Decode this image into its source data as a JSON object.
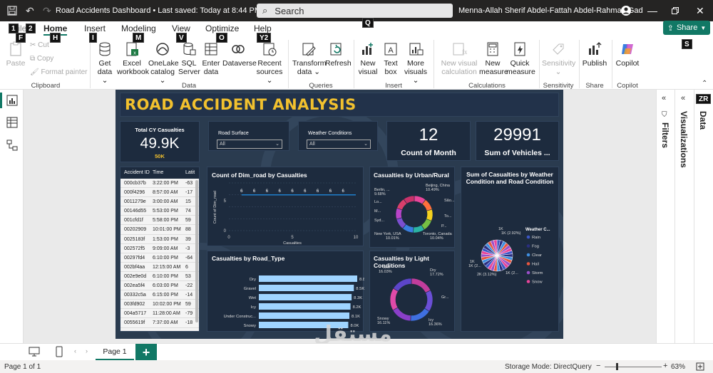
{
  "window": {
    "title": "Road Accidents Dashboard",
    "saved": "Last saved: Today at 8:44 PM",
    "search_placeholder": "Search",
    "user": "Menna-Allah Sherif Abdel-Fattah Abdel-Rahman Gad"
  },
  "keytips": [
    "1",
    "2",
    "F",
    "H",
    "I",
    "M",
    "V",
    "O",
    "Y2",
    "Q",
    "S",
    "ZR"
  ],
  "tabs": [
    "File",
    "Home",
    "Insert",
    "Modeling",
    "View",
    "Optimize",
    "Help"
  ],
  "share_label": "Share",
  "ribbon": {
    "clipboard": {
      "paste": "Paste",
      "cut": "Cut",
      "copy": "Copy",
      "format_painter": "Format painter",
      "label": "Clipboard"
    },
    "data": {
      "get_data": [
        "Get",
        "data"
      ],
      "excel": [
        "Excel",
        "workbook"
      ],
      "onelake": [
        "OneLake",
        "catalog"
      ],
      "sql": [
        "SQL",
        "Server"
      ],
      "enter": [
        "Enter",
        "data"
      ],
      "dataverse": "Dataverse",
      "recent": [
        "Recent",
        "sources"
      ],
      "label": "Data"
    },
    "queries": {
      "transform": [
        "Transform",
        "data"
      ],
      "refresh": "Refresh",
      "label": "Queries"
    },
    "insert": {
      "new_visual": [
        "New",
        "visual"
      ],
      "text_box": [
        "Text",
        "box"
      ],
      "more_visuals": [
        "More",
        "visuals"
      ],
      "label": "Insert"
    },
    "calculations": {
      "new_visual_calc": [
        "New visual",
        "calculation"
      ],
      "new_measure": [
        "New",
        "measure"
      ],
      "quick_measure": [
        "Quick",
        "measure"
      ],
      "label": "Calculations"
    },
    "sensitivity": {
      "btn": "Sensitivity",
      "label": "Sensitivity"
    },
    "share": {
      "publish": "Publish",
      "label": "Share"
    },
    "copilot": {
      "btn": "Copilot",
      "label": "Copilot"
    }
  },
  "panes": {
    "filters": "Filters",
    "visualizations": "Visualizations",
    "data": "Data"
  },
  "report": {
    "title": "ROAD ACCIDENT ANALYSIS",
    "kpi_total": {
      "label": "Total CY Casualties",
      "value": "49.9K",
      "sub": "50K"
    },
    "slicer_road": {
      "label": "Road Surface",
      "value": "All"
    },
    "slicer_weather": {
      "label": "Weather Conditions",
      "value": "All"
    },
    "kpi_month": {
      "value": "12",
      "label": "Count of Month"
    },
    "kpi_vehicles": {
      "value": "29991",
      "label": "Sum of Vehicles ..."
    },
    "table": {
      "headers": [
        "Accident ID",
        "Time",
        "Latit"
      ],
      "rows": [
        [
          "000cb37b",
          "3:22:00 PM",
          "-63"
        ],
        [
          "000f4296",
          "8:57:00 AM",
          "-17"
        ],
        [
          "0011279e",
          "3:00:00 AM",
          "15"
        ],
        [
          "00146d55",
          "5:53:00 PM",
          "74"
        ],
        [
          "001cfd1f",
          "5:58:00 PM",
          "59"
        ],
        [
          "00202909",
          "10:01:00 PM",
          "88"
        ],
        [
          "0025183f",
          "1:53:00 PM",
          "39"
        ],
        [
          "002572f5",
          "9:09:00 AM",
          "-3"
        ],
        [
          "00297fd4",
          "6:10:00 PM",
          "-64"
        ],
        [
          "002bf4aa",
          "12:15:00 AM",
          "6"
        ],
        [
          "002e9e0d",
          "6:10:00 PM",
          "53"
        ],
        [
          "002ea5f4",
          "6:03:00 PM",
          "-22"
        ],
        [
          "00332c5a",
          "6:15:00 PM",
          "-14"
        ],
        [
          "003fd902",
          "10:02:00 PM",
          "59"
        ],
        [
          "004a5717",
          "11:28:00 AM",
          "-79"
        ],
        [
          "0055619f",
          "7:37:00 AM",
          "-18"
        ]
      ]
    },
    "line_title": "Count of Dim_road by Casualties",
    "bar_title": "Casualties by Road_Type",
    "donut1_title": "Casualties by Urban/Rural",
    "donut2_title": "Casualties by Light Conditions",
    "pie_title": [
      "Sum of Casualties by Weather",
      "Condition and Road Condition"
    ]
  },
  "chart_data": [
    {
      "type": "line",
      "title": "Count of Dim_road by Casualties",
      "xlabel": "Casualties",
      "ylabel": "Count of Dim_road",
      "x": [
        1,
        2,
        3,
        4,
        5,
        6,
        7,
        8,
        9,
        10
      ],
      "series": [
        {
          "values": [
            6,
            6,
            6,
            6,
            6,
            6,
            6,
            6,
            6,
            6
          ]
        }
      ],
      "xlim": [
        0,
        10
      ],
      "x_ticks": [
        "0",
        "5",
        "10"
      ],
      "y_ticks": [
        "0",
        "5"
      ],
      "ylim": [
        0,
        8
      ],
      "point_labels": [
        "6",
        "6",
        "6",
        "6",
        "6",
        "6",
        "6",
        "6",
        "6"
      ],
      "line_color": "#1f8fe8",
      "grid": true
    },
    {
      "type": "bar",
      "orientation": "horizontal",
      "title": "Casualties by Road_Type",
      "categories": [
        "Dry",
        "Gravel",
        "Wet",
        "Icy",
        "Under Construc...",
        "Snowy"
      ],
      "values": [
        8800,
        8500,
        8300,
        8200,
        8100,
        8000
      ],
      "labels": [
        "8.8K",
        "8.5K",
        "8.3K",
        "8.2K",
        "8.1K",
        "8.0K"
      ],
      "color": "#9fd4ff"
    },
    {
      "type": "pie",
      "variant": "donut",
      "title": "Casualties by Urban/Rural",
      "slices": [
        {
          "label": "Beijing, China",
          "pct": "10.49%",
          "value": 10.49,
          "color": "#e8459a"
        },
        {
          "label": "São...",
          "pct": "",
          "value": 10.2,
          "color": "#ff6f3c"
        },
        {
          "label": "To...",
          "pct": "",
          "value": 10.1,
          "color": "#f5d11e"
        },
        {
          "label": "P...",
          "pct": "",
          "value": 9.9,
          "color": "#76c043"
        },
        {
          "label": "Toronto, Canada",
          "pct": "10.04%",
          "value": 10.04,
          "color": "#2bb3a3"
        },
        {
          "label": "New York, USA",
          "pct": "10.01%",
          "value": 10.01,
          "color": "#3a7fe0"
        },
        {
          "label": "Syd...",
          "pct": "",
          "value": 9.8,
          "color": "#7b4fd0"
        },
        {
          "label": "M...",
          "pct": "",
          "value": 9.7,
          "color": "#b844c9"
        },
        {
          "label": "Lo...",
          "pct": "",
          "value": 9.78,
          "color": "#d93f6b"
        },
        {
          "label": "Berlin, ...",
          "pct": "9.68%",
          "value": 9.68,
          "color": "#c8326a"
        }
      ]
    },
    {
      "type": "pie",
      "variant": "donut",
      "title": "Casualties by Light Conditions",
      "slices": [
        {
          "label": "Dry",
          "pct": "17.72%",
          "value": 17.72,
          "color": "#c23d9c"
        },
        {
          "label": "Gr...",
          "pct": "",
          "value": 16.5,
          "color": "#6b4fd6"
        },
        {
          "label": "Icy",
          "pct": "16.36%",
          "value": 16.36,
          "color": "#3f6fe0"
        },
        {
          "label": "Snowy",
          "pct": "16.11%",
          "value": 16.11,
          "color": "#8a3fc9"
        },
        {
          "label": "",
          "pct": "",
          "value": 17.2,
          "color": "#e04aa8"
        },
        {
          "label": "Wet",
          "pct": "16.03%",
          "value": 16.03,
          "color": "#5c45c8"
        }
      ]
    },
    {
      "type": "pie",
      "title": "Sum of Casualties by Weather Condition and Road Condition",
      "legend_title": "Weather C...",
      "legend": [
        {
          "name": "Rain",
          "color": "#3b56c6"
        },
        {
          "name": "Fog",
          "color": "#2a2e80"
        },
        {
          "name": "Clear",
          "color": "#3f8fe0"
        },
        {
          "name": "Hail",
          "color": "#e8563f"
        },
        {
          "name": "Storm",
          "color": "#9b4fc9"
        },
        {
          "name": "Snow",
          "color": "#e8459a"
        }
      ],
      "slice_labels": [
        "1K (2.92%)",
        "1K",
        "1K",
        "1K (2...",
        "2K (3.12%)",
        "1K (2..."
      ],
      "slices": 30
    }
  ],
  "pagebar": {
    "page_label": "Page 1"
  },
  "status": {
    "page_of": "Page 1 of 1",
    "storage": "Storage Mode: DirectQuery",
    "zoom": "63%"
  },
  "watermark": "مستقل"
}
